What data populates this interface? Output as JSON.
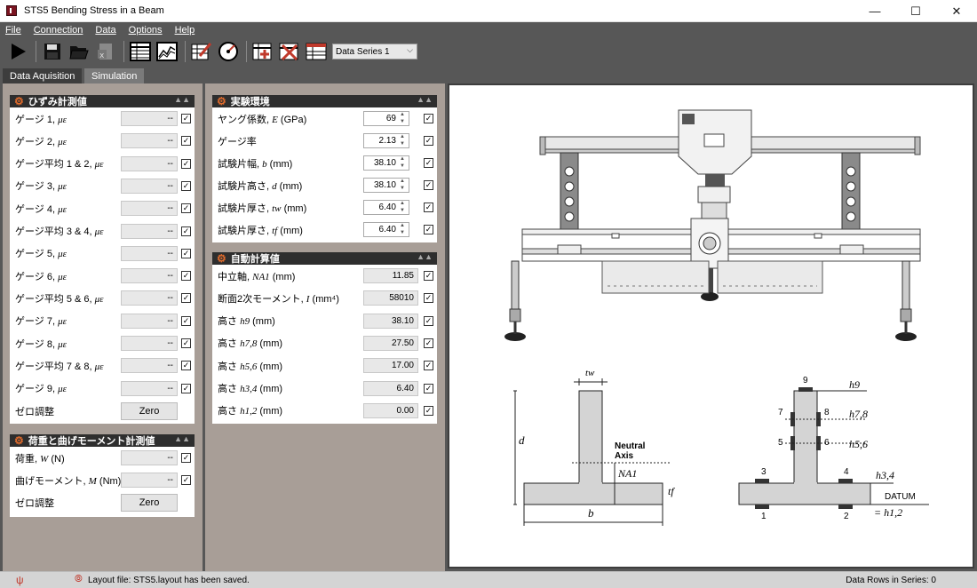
{
  "window": {
    "title": "STS5 Bending Stress in a Beam"
  },
  "menu": [
    "File",
    "Connection",
    "Data",
    "Options",
    "Help"
  ],
  "toolbar": {
    "series_selected": "Data Series 1"
  },
  "tabs": [
    "Data Aquisition",
    "Simulation"
  ],
  "panels": {
    "strain": {
      "title": "ひずみ計測値",
      "rows": [
        {
          "label": "ゲージ 1, ",
          "unit": "με",
          "value": "--"
        },
        {
          "label": "ゲージ 2, ",
          "unit": "με",
          "value": "--"
        },
        {
          "label": "ゲージ平均 1 & 2, ",
          "unit": "με",
          "value": "--"
        },
        {
          "label": "ゲージ 3, ",
          "unit": "με",
          "value": "--"
        },
        {
          "label": "ゲージ 4, ",
          "unit": "με",
          "value": "--"
        },
        {
          "label": "ゲージ平均 3 & 4, ",
          "unit": "με",
          "value": "--"
        },
        {
          "label": "ゲージ 5, ",
          "unit": "με",
          "value": "--"
        },
        {
          "label": "ゲージ 6, ",
          "unit": "με",
          "value": "--"
        },
        {
          "label": "ゲージ平均 5 & 6, ",
          "unit": "με",
          "value": "--"
        },
        {
          "label": "ゲージ 7, ",
          "unit": "με",
          "value": "--"
        },
        {
          "label": "ゲージ 8, ",
          "unit": "με",
          "value": "--"
        },
        {
          "label": "ゲージ平均 7 & 8, ",
          "unit": "με",
          "value": "--"
        },
        {
          "label": "ゲージ 9, ",
          "unit": "με",
          "value": "--"
        }
      ],
      "zero_label": "ゼロ調整",
      "zero_button": "Zero"
    },
    "load": {
      "title": "荷重と曲げモーメント計測値",
      "rows": [
        {
          "label": "荷重, ",
          "unit": "W",
          "suffix": " (N)",
          "value": "--"
        },
        {
          "label": "曲げモーメント, ",
          "unit": "M",
          "suffix": " (Nm)",
          "value": "--"
        }
      ],
      "zero_label": "ゼロ調整",
      "zero_button": "Zero"
    },
    "env": {
      "title": "実験環境",
      "rows": [
        {
          "label": "ヤング係数, ",
          "unit": "E",
          "suffix": "  (GPa)",
          "value": "69"
        },
        {
          "label": "ゲージ率",
          "unit": "",
          "suffix": "",
          "value": "2.13"
        },
        {
          "label": "試験片幅, ",
          "unit": "b",
          "suffix": " (mm)",
          "value": "38.10"
        },
        {
          "label": "試験片高さ, ",
          "unit": "d",
          "suffix": " (mm)",
          "value": "38.10"
        },
        {
          "label": "試験片厚さ, ",
          "unit": "tw",
          "suffix": " (mm)",
          "value": "6.40"
        },
        {
          "label": "試験片厚さ, ",
          "unit": "tf",
          "suffix": " (mm)",
          "value": "6.40"
        }
      ]
    },
    "auto": {
      "title": "自動計算値",
      "rows": [
        {
          "label": "中立軸, ",
          "unit": "NA1",
          "suffix": " (mm)",
          "value": "11.85"
        },
        {
          "label": "断面2次モーメント, ",
          "unit": "I",
          "suffix": " (mm⁴)",
          "value": "58010"
        },
        {
          "label": "高さ ",
          "unit": "h9",
          "suffix": " (mm)",
          "value": "38.10"
        },
        {
          "label": "高さ ",
          "unit": "h7,8",
          "suffix": " (mm)",
          "value": "27.50"
        },
        {
          "label": "高さ ",
          "unit": "h5,6",
          "suffix": " (mm)",
          "value": "17.00"
        },
        {
          "label": "高さ ",
          "unit": "h3,4",
          "suffix": " (mm)",
          "value": "6.40"
        },
        {
          "label": "高さ ",
          "unit": "h1,2",
          "suffix": " (mm)",
          "value": "0.00"
        }
      ]
    }
  },
  "diagram": {
    "tw": "tw",
    "d": "d",
    "neutral": "Neutral",
    "axis": "Axis",
    "na": "NA1",
    "tf": "tf",
    "b": "b",
    "gauges": [
      "9",
      "7",
      "8",
      "5",
      "6",
      "3",
      "4",
      "1",
      "2"
    ],
    "h9": "h9",
    "h78": "h7,8",
    "h56": "h5,6",
    "h34": "h3,4",
    "datum": "DATUM",
    "h12": "= h1,2"
  },
  "status": {
    "message": "Layout file: STS5.layout has been saved.",
    "rows": "Data Rows in Series: 0"
  }
}
